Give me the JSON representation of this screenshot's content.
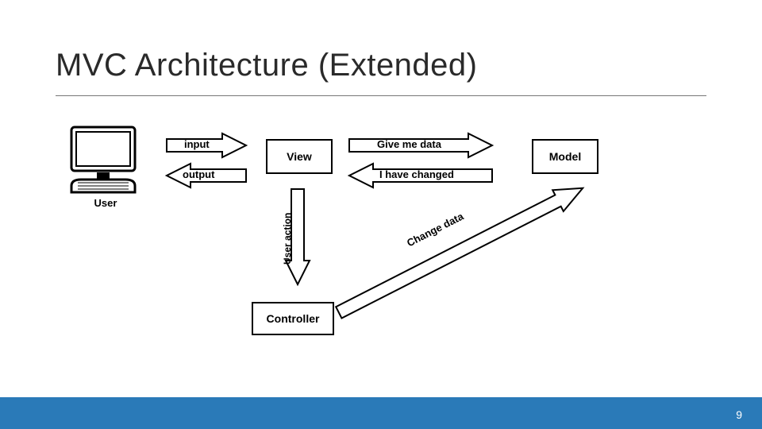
{
  "title": "MVC Architecture (Extended)",
  "page_number": "9",
  "diagram": {
    "nodes": {
      "user": "User",
      "view": "View",
      "model": "Model",
      "controller": "Controller"
    },
    "arrows": {
      "input": "input",
      "output": "output",
      "give_me_data": "Give me data",
      "i_have_changed": "I have changed",
      "user_action": "User action",
      "change_data": "Change data"
    }
  },
  "colors": {
    "footer": "#2a7ab8",
    "stroke": "#000000"
  }
}
